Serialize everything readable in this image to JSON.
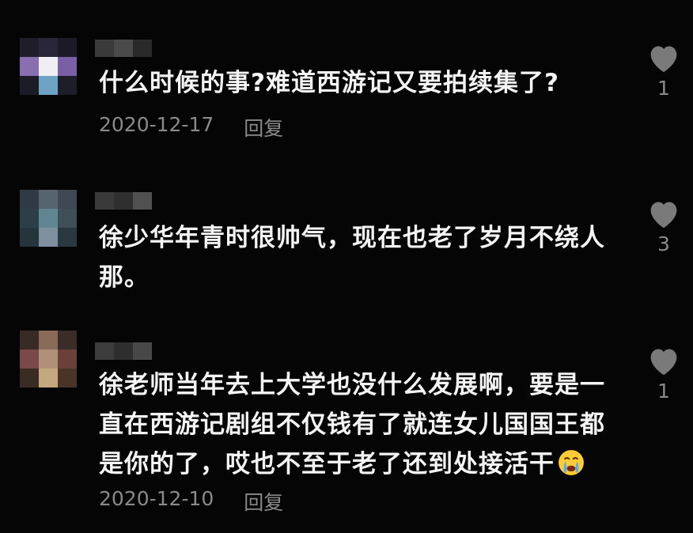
{
  "comments": [
    {
      "text": "什么时候的事?难道西游记又要拍续集了?",
      "date": "2020-12-17",
      "reply_label": "回复",
      "likes": "1",
      "avatar_colors": [
        "#1f1d2a",
        "#2a263a",
        "#1c1a26",
        "#8a6fb0",
        "#f0eef5",
        "#7a5fa5",
        "#1c1c26",
        "#6fa3c6",
        "#1e1e2a"
      ],
      "username_colors": [
        "#3a3a3a",
        "#4a4a4a",
        "#2a2a2a"
      ]
    },
    {
      "text": "徐少华年青时很帅气，现在也老了岁月不绕人那。",
      "date": "",
      "reply_label": "",
      "likes": "3",
      "avatar_colors": [
        "#2f3a44",
        "#55646e",
        "#3d4852",
        "#2c3f46",
        "#5f8692",
        "#3e4f58",
        "#26343c",
        "#7f8fa0",
        "#2a3840"
      ],
      "username_colors": [
        "#3a3a3a",
        "#2f2f2f",
        "#505050"
      ]
    },
    {
      "text": "徐老师当年去上大学也没什么发展啊，要是一直在西游记剧组不仅钱有了就连女儿国国王都是你的了，哎也不至于老了还到处接活干",
      "date": "2020-12-10",
      "reply_label": "回复",
      "likes": "1",
      "avatar_colors": [
        "#3a2a26",
        "#8a6a58",
        "#3a2c28",
        "#7a4a4a",
        "#b09078",
        "#6a4038",
        "#3a2c24",
        "#c4a880",
        "#4a3428"
      ],
      "username_colors": [
        "#3c3c3c",
        "#2e2e2e",
        "#484848"
      ]
    }
  ],
  "icons": {
    "like": "heart-icon",
    "emoji": "crying-face-emoji"
  }
}
